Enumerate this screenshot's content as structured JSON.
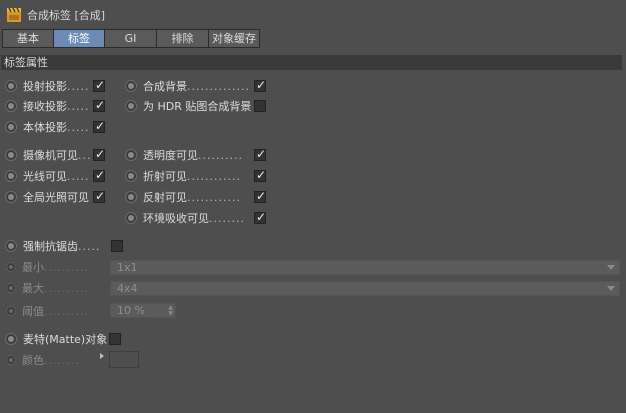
{
  "window": {
    "title": "合成标签 [合成]"
  },
  "tabs": [
    "基本",
    "标签",
    "GI",
    "排除",
    "对象缓存"
  ],
  "active_tab": "标签",
  "section": {
    "title": "标签属性"
  },
  "left_col": [
    {
      "label": "投射投影",
      "dots": ".....",
      "checked": true
    },
    {
      "label": "接收投影",
      "dots": ".....",
      "checked": true
    },
    {
      "label": "本体投影",
      "dots": ".....",
      "checked": true
    }
  ],
  "right_col": [
    {
      "label": "合成背景",
      "dots": "..............",
      "checked": true
    },
    {
      "label": "为 HDR 贴图合成背景",
      "dots": "",
      "checked": false
    }
  ],
  "vis_left": [
    {
      "label": "摄像机可见",
      "dots": "...",
      "checked": true
    },
    {
      "label": "光线可见",
      "dots": ".....",
      "checked": true
    },
    {
      "label": "全局光照可见",
      "dots": "",
      "checked": true
    }
  ],
  "vis_right": [
    {
      "label": "透明度可见",
      "dots": "..........",
      "checked": true
    },
    {
      "label": "折射可见",
      "dots": "............",
      "checked": true
    },
    {
      "label": "反射可见",
      "dots": "............",
      "checked": true
    },
    {
      "label": "环境吸收可见",
      "dots": "........",
      "checked": true
    }
  ],
  "antialias": {
    "label": "强制抗锯齿",
    "dots": ".....",
    "checked": false,
    "min": {
      "label": "最小",
      "dots": "..........",
      "value": "1x1"
    },
    "max": {
      "label": "最大",
      "dots": "..........",
      "value": "4x4"
    },
    "threshold": {
      "label": "阈值",
      "dots": "..........",
      "value": "10 %"
    }
  },
  "matte": {
    "label": "麦特(Matte)对象",
    "checked": false,
    "color": {
      "label": "颜色",
      "dots": "........",
      "value_hex": "#4e4e4e"
    }
  },
  "colors": {
    "background": "#4e4e4e",
    "tab_active": "#6c8bb4",
    "section": "#3a3a3a"
  }
}
